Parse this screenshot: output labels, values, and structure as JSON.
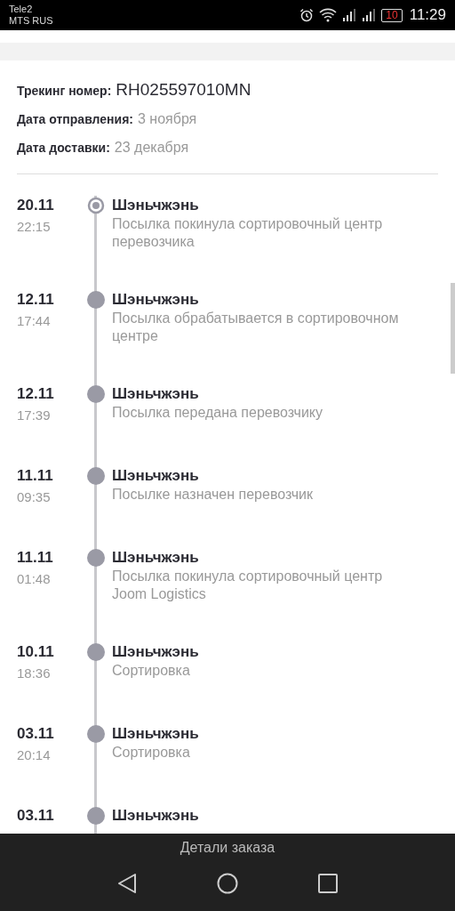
{
  "status_bar": {
    "carrier_1": "Tele2",
    "carrier_2": "MTS RUS",
    "battery": "10",
    "time": "11:29"
  },
  "shipment": [
    {
      "label": "Трекинг номер:",
      "value": "RH025597010MN",
      "kind": "large"
    },
    {
      "label": "Дата отправления:",
      "value": "3 ноября",
      "kind": "normal"
    },
    {
      "label": "Дата доставки:",
      "value": "23 декабря",
      "kind": "normal"
    }
  ],
  "events": [
    {
      "date": "20.11",
      "time": "22:15",
      "place": "Шэньчжэнь",
      "description": "Посылка покинула сортировочный центр перевозчика",
      "current": true
    },
    {
      "date": "12.11",
      "time": "17:44",
      "place": "Шэньчжэнь",
      "description": "Посылка обрабатывается в сортировочном центре",
      "current": false
    },
    {
      "date": "12.11",
      "time": "17:39",
      "place": "Шэньчжэнь",
      "description": "Посылка передана перевозчику",
      "current": false
    },
    {
      "date": "11.11",
      "time": "09:35",
      "place": "Шэньчжэнь",
      "description": "Посылке назначен перевозчик",
      "current": false
    },
    {
      "date": "11.11",
      "time": "01:48",
      "place": "Шэньчжэнь",
      "description": "Посылка покинула сортировочный центр Joom Logistics",
      "current": false
    },
    {
      "date": "10.11",
      "time": "18:36",
      "place": "Шэньчжэнь",
      "description": "Сортировка",
      "current": false
    },
    {
      "date": "03.11",
      "time": "20:14",
      "place": "Шэньчжэнь",
      "description": "Сортировка",
      "current": false
    },
    {
      "date": "03.11",
      "place": "Шэньчжэнь",
      "current": false
    }
  ],
  "bottom_bar": {
    "title": "Детали заказа"
  }
}
